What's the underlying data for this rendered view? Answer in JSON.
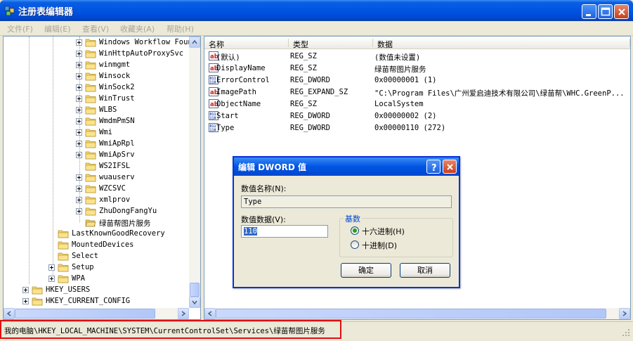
{
  "window": {
    "title": "注册表编辑器"
  },
  "menu": [
    {
      "label": "文件(F)"
    },
    {
      "label": "编辑(E)"
    },
    {
      "label": "查看(V)"
    },
    {
      "label": "收藏夹(A)"
    },
    {
      "label": "帮助(H)"
    }
  ],
  "tree": {
    "items": [
      {
        "label": "Windows Workflow Foun",
        "expandable": true
      },
      {
        "label": "WinHttpAutoProxySvc",
        "expandable": true
      },
      {
        "label": "winmgmt",
        "expandable": true
      },
      {
        "label": "Winsock",
        "expandable": true
      },
      {
        "label": "WinSock2",
        "expandable": true
      },
      {
        "label": "WinTrust",
        "expandable": true
      },
      {
        "label": "WLBS",
        "expandable": true
      },
      {
        "label": "WmdmPmSN",
        "expandable": true
      },
      {
        "label": "Wmi",
        "expandable": true
      },
      {
        "label": "WmiApRpl",
        "expandable": true
      },
      {
        "label": "WmiApSrv",
        "expandable": true
      },
      {
        "label": "WS2IFSL",
        "expandable": false
      },
      {
        "label": "wuauserv",
        "expandable": true
      },
      {
        "label": "WZCSVC",
        "expandable": true
      },
      {
        "label": "xmlprov",
        "expandable": true
      },
      {
        "label": "ZhuDongFangYu",
        "expandable": true
      },
      {
        "label": "绿苗帮图片服务",
        "expandable": false,
        "open": true
      },
      {
        "label": "LastKnownGoodRecovery",
        "expandable": false
      },
      {
        "label": "MountedDevices",
        "expandable": false
      },
      {
        "label": "Select",
        "expandable": false
      },
      {
        "label": "Setup",
        "expandable": true
      },
      {
        "label": "WPA",
        "expandable": true
      },
      {
        "label": "HKEY_USERS",
        "expandable": true
      },
      {
        "label": "HKEY_CURRENT_CONFIG",
        "expandable": true
      }
    ]
  },
  "list": {
    "headers": {
      "name": "名称",
      "type": "类型",
      "data": "数据"
    },
    "rows": [
      {
        "icon": "string-value-icon",
        "name": "(默认)",
        "type": "REG_SZ",
        "data": "(数值未设置)"
      },
      {
        "icon": "string-value-icon",
        "name": "DisplayName",
        "type": "REG_SZ",
        "data": "绿苗帮图片服务"
      },
      {
        "icon": "binary-value-icon",
        "name": "ErrorControl",
        "type": "REG_DWORD",
        "data": "0x00000001 (1)"
      },
      {
        "icon": "string-value-icon",
        "name": "ImagePath",
        "type": "REG_EXPAND_SZ",
        "data": "\"C:\\Program Files\\广州爱启迪技术有限公司\\绿苗帮\\WHC.GreenP..."
      },
      {
        "icon": "string-value-icon",
        "name": "ObjectName",
        "type": "REG_SZ",
        "data": "LocalSystem"
      },
      {
        "icon": "binary-value-icon",
        "name": "Start",
        "type": "REG_DWORD",
        "data": "0x00000002 (2)"
      },
      {
        "icon": "binary-value-icon",
        "name": "Type",
        "type": "REG_DWORD",
        "data": "0x00000110 (272)"
      }
    ]
  },
  "dialog": {
    "title": "编辑 DWORD 值",
    "name_label": "数值名称(N):",
    "name_value": "Type",
    "data_label": "数值数据(V):",
    "data_value": "110",
    "base_label": "基数",
    "hex_label": "十六进制(H)",
    "dec_label": "十进制(D)",
    "ok_label": "确定",
    "cancel_label": "取消"
  },
  "status": {
    "path": "我的电脑\\HKEY_LOCAL_MACHINE\\SYSTEM\\CurrentControlSet\\Services\\绿苗帮图片服务"
  },
  "colors": {
    "titlebar": "#0054e3",
    "highlight_border": "#e01010",
    "dialog_border": "#0831d9"
  }
}
